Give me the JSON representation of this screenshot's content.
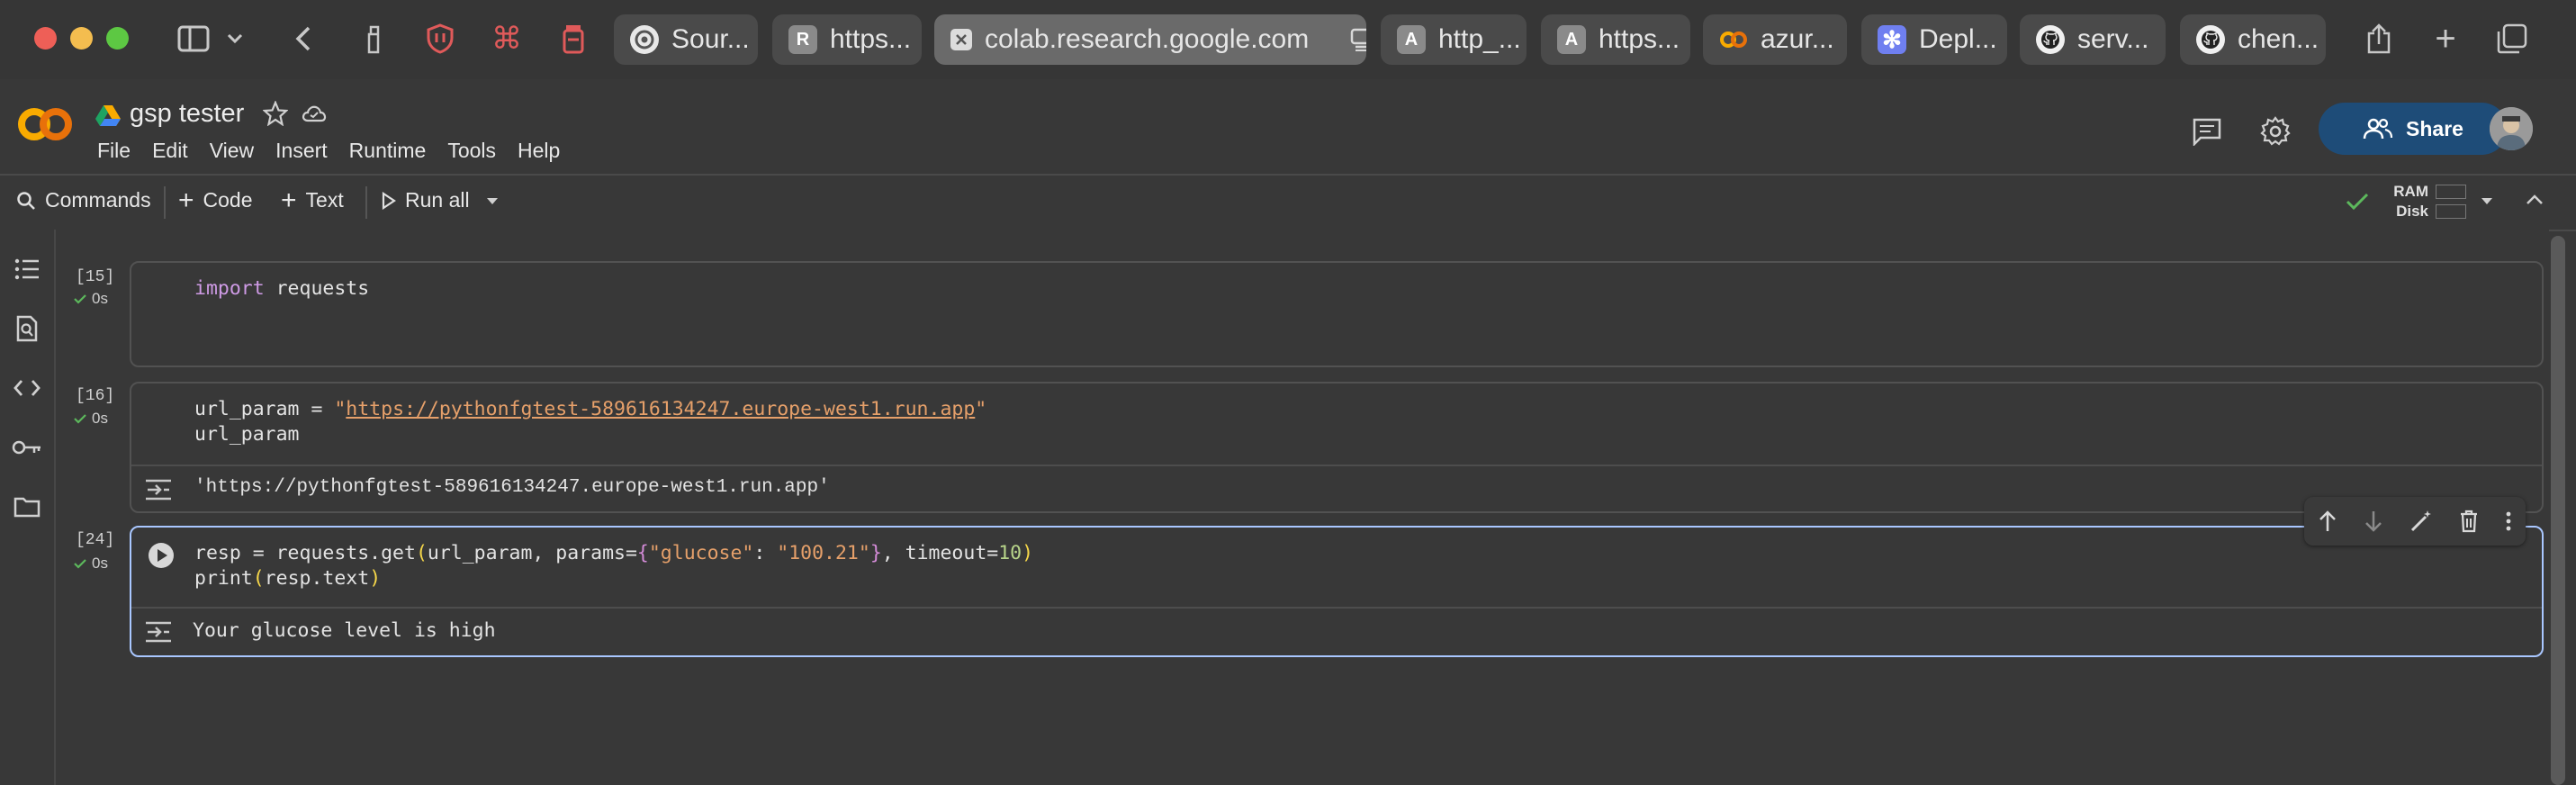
{
  "browser": {
    "tabs": [
      {
        "label": "Sour...",
        "icon": "chrome-source-icon"
      },
      {
        "label": "https...",
        "icon": "r-letter-icon"
      },
      {
        "label": "colab.research.google.com",
        "icon": "close-icon",
        "active": true
      },
      {
        "label": "http_...",
        "icon": "a-letter-icon"
      },
      {
        "label": "https...",
        "icon": "a-letter-icon"
      },
      {
        "label": "azur...",
        "icon": "colab-logo-icon"
      },
      {
        "label": "Depl...",
        "icon": "asterisk-logo-icon"
      },
      {
        "label": "serv...",
        "icon": "github-icon"
      },
      {
        "label": "chen...",
        "icon": "github-icon"
      }
    ]
  },
  "header": {
    "title": "gsp tester",
    "menu": [
      "File",
      "Edit",
      "View",
      "Insert",
      "Runtime",
      "Tools",
      "Help"
    ],
    "share_label": "Share"
  },
  "toolbar": {
    "commands": "Commands",
    "code": "Code",
    "text": "Text",
    "run_all": "Run all",
    "ram": "RAM",
    "disk": "Disk"
  },
  "cells": [
    {
      "exec": "[15]",
      "time": "0s",
      "code": [
        "import requests"
      ],
      "output": null
    },
    {
      "exec": "[16]",
      "time": "0s",
      "code": [
        "url_param = \"https://pythonfgtest-589616134247.europe-west1.run.app\"",
        "url_param"
      ],
      "output": "'https://pythonfgtest-589616134247.europe-west1.run.app'"
    },
    {
      "exec": "[24]",
      "time": "0s",
      "code": [
        "resp = requests.get(url_param, params={\"glucose\": \"100.21\"}, timeout=10)",
        "print(resp.text)"
      ],
      "output": "Your glucose level is high"
    }
  ],
  "code_tokens": {
    "import_kw": "import",
    "requests_mod": " requests",
    "url_param_assign": "url_param = ",
    "quote": "\"",
    "url": "https://pythonfgtest-589616134247.europe-west1.run.app",
    "url_param_ref": "url_param",
    "resp_assign": "resp = requests.get",
    "open_paren": "(",
    "close_paren": ")",
    "args_1": "url_param, params=",
    "open_brace": "{",
    "close_brace": "}",
    "key": "\"glucose\"",
    "colon": ": ",
    "value": "\"100.21\"",
    "timeout_arg": ", timeout=",
    "timeout_val": "10",
    "print_fn": "print",
    "resp_text": "resp.text"
  },
  "colors": {
    "accent_share": "#1e4c78",
    "focus_border": "#a9c7ff",
    "keyword": "#cf9be6",
    "string": "#e6a06a",
    "number": "#b8d58a",
    "success": "#5cb85c"
  }
}
